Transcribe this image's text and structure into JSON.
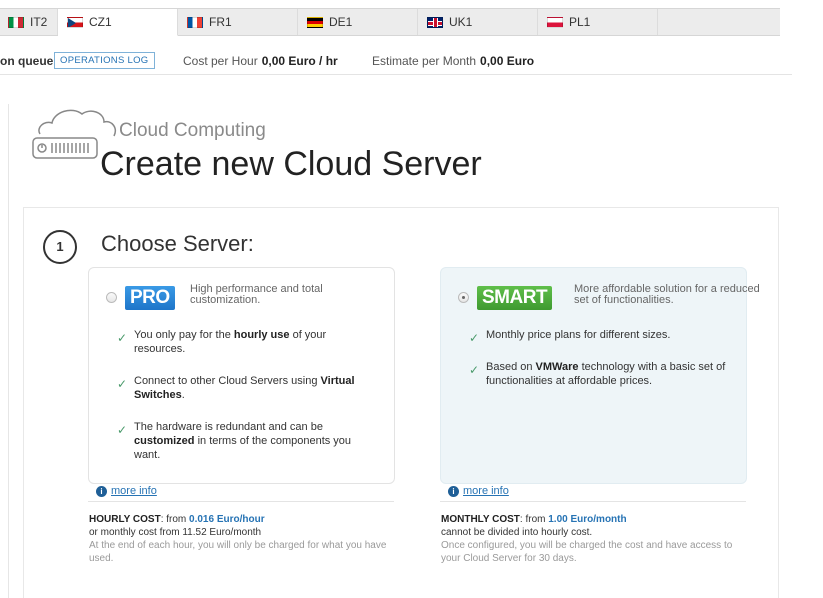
{
  "tabs": [
    {
      "code": "IT2",
      "flag": "flag-it",
      "active": false
    },
    {
      "code": "CZ1",
      "flag": "flag-cz",
      "active": true
    },
    {
      "code": "FR1",
      "flag": "flag-fr",
      "active": false
    },
    {
      "code": "DE1",
      "flag": "flag-de",
      "active": false
    },
    {
      "code": "UK1",
      "flag": "flag-uk",
      "active": false
    },
    {
      "code": "PL1",
      "flag": "flag-pl",
      "active": false
    }
  ],
  "infobar": {
    "queue_label": "on queue",
    "operations_log": "OPERATIONS LOG",
    "cost_per_hour_label": "Cost per Hour",
    "cost_per_hour_value": "0,00 Euro / hr",
    "estimate_label": "Estimate per Month",
    "estimate_value": "0,00 Euro"
  },
  "header": {
    "subtitle": "Cloud Computing",
    "title": "Create new Cloud Server"
  },
  "step": {
    "number": "1",
    "title": "Choose Server:"
  },
  "pro": {
    "badge": "PRO",
    "desc": "High performance and total customization.",
    "selected": false,
    "features": [
      {
        "pre": "You only pay for the ",
        "bold": "hourly use",
        "post": " of your resources."
      },
      {
        "pre": "Connect to other Cloud Servers using ",
        "bold": "Virtual Switches",
        "post": "."
      },
      {
        "pre": "The hardware is redundant and can be ",
        "bold": "customized",
        "post": " in terms of the components you want."
      }
    ],
    "more_info": "more info",
    "cost_label": "HOURLY COST",
    "cost_from": ": from ",
    "cost_value": "0.016 Euro/hour",
    "cost_sub": "or monthly cost from 11.52 Euro/month",
    "cost_note": "At the end of each hour, you will only be charged for what you have used."
  },
  "smart": {
    "badge": "SMART",
    "desc": "More affordable solution for a reduced set of functionalities.",
    "selected": true,
    "features": [
      {
        "pre": "Monthly price plans for different sizes.",
        "bold": "",
        "post": ""
      },
      {
        "pre": "Based on ",
        "bold": "VMWare",
        "post": " technology with a basic set of functionalities at affordable prices."
      }
    ],
    "more_info": "more info",
    "cost_label": "MONTHLY COST",
    "cost_from": ": from ",
    "cost_value": "1.00 Euro/month",
    "cost_sub": "cannot be divided into hourly cost.",
    "cost_note": "Once configured, you will be charged the cost and have access to your Cloud Server for 30 days."
  },
  "icons": {
    "check": "✓",
    "info": "i"
  }
}
